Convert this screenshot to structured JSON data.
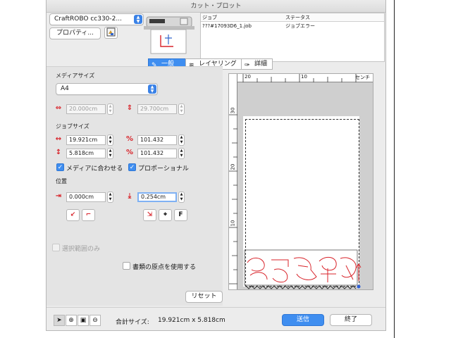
{
  "window": {
    "title": "カット・プロット"
  },
  "printer": {
    "selected": "CraftROBO cc330-2...",
    "properties_label": "プロパティ..."
  },
  "jobs": {
    "columns": [
      "ジョブ",
      "ステータス"
    ],
    "rows": [
      {
        "name": "???#17093D6_1.job",
        "status": "ジョブエラー"
      }
    ]
  },
  "tabs": [
    {
      "label": "一般",
      "selected": true
    },
    {
      "label": "レイヤリング",
      "selected": false
    },
    {
      "label": "詳細",
      "selected": false
    }
  ],
  "media": {
    "heading": "メディアサイズ",
    "selected": "A4",
    "width": "20.000cm",
    "height": "29.700cm"
  },
  "job_size": {
    "heading": "ジョブサイズ",
    "width": "19.921cm",
    "height": "5.818cm",
    "scale_x": "101.432",
    "scale_y": "101.432",
    "fit_media_label": "メディアに合わせる",
    "fit_media_checked": true,
    "proportional_label": "プロポーショナル",
    "proportional_checked": true
  },
  "position": {
    "heading": "位置",
    "x": "0.000cm",
    "y": "0.254cm"
  },
  "options": {
    "selection_only_label": "選択範囲のみ",
    "doc_origin_label": "書類の原点を使用する",
    "reset_label": "リセット"
  },
  "preview": {
    "unit": "センチ",
    "top_ticks": [
      "20",
      "10"
    ],
    "left_ticks": [
      "30",
      "20",
      "10"
    ]
  },
  "footer": {
    "total_size_label": "合計サイズ:",
    "total_size_value": "19.921cm x 5.818cm",
    "send_label": "送信",
    "close_label": "終了"
  },
  "colors": {
    "accent": "#3f8ef0",
    "cut_lines": "#d8232a"
  }
}
